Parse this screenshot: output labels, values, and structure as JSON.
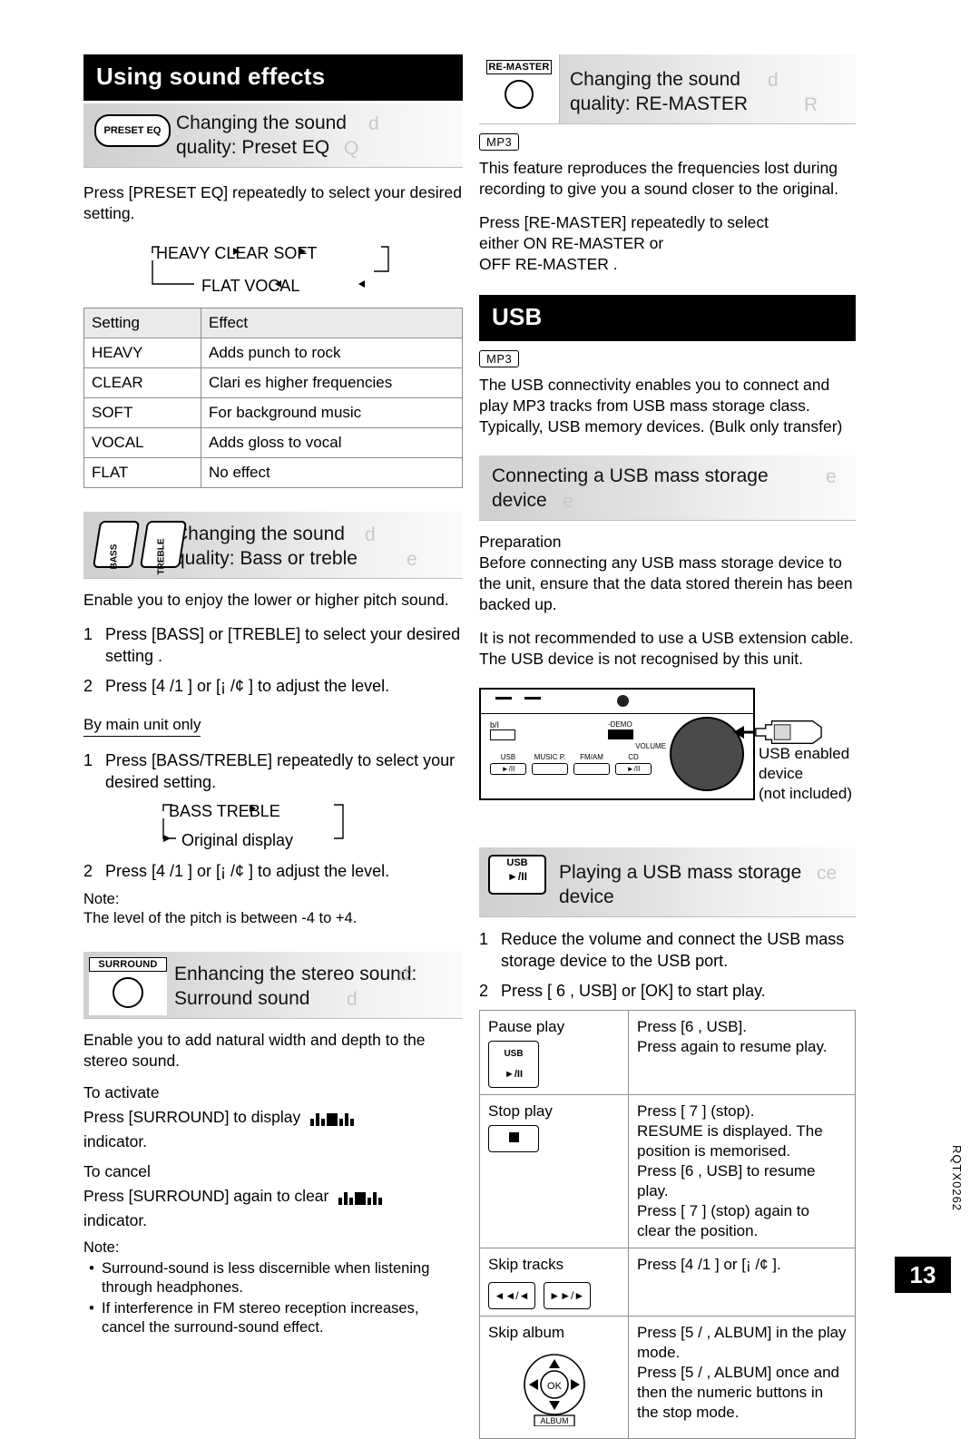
{
  "left": {
    "section_title": "Using sound effects",
    "preset_eq": {
      "icon_label": "PRESET EQ",
      "heading_line1": "Changing the sound",
      "heading_line2": "quality: Preset EQ",
      "ghost1": "d",
      "ghost2": "Q",
      "intro": "Press [PRESET EQ] repeatedly to select your desired setting.",
      "flow_top": "HEAVY       CLEAR       SOFT",
      "flow_bottom": "FLAT       VOCAL",
      "table": {
        "headers": [
          "Setting",
          "Effect"
        ],
        "rows": [
          [
            "HEAVY",
            "Adds punch to rock"
          ],
          [
            "CLEAR",
            "Clari es higher frequencies"
          ],
          [
            "SOFT",
            "For background music"
          ],
          [
            "VOCAL",
            "Adds gloss to vocal"
          ],
          [
            "FLAT",
            "No effect"
          ]
        ]
      }
    },
    "bass_treble": {
      "icon_bass": "BASS",
      "icon_treble": "TREBLE",
      "heading_line1": "Changing the sound",
      "heading_line2": "quality: Bass or treble",
      "ghost1": "d",
      "ghost2": "e",
      "intro": "Enable you to enjoy the lower or higher pitch sound.",
      "steps": [
        {
          "n": "1",
          "text": "Press [BASS] or [TREBLE] to select your desired setting ."
        },
        {
          "n": "2",
          "text": "Press  [4      /1     ] or [¡      /¢     ]  to  adjust  the level."
        }
      ],
      "mainunit_label": "By main unit only",
      "steps2": [
        {
          "n": "1",
          "text": "Press [BASS/TREBLE] repeatedly to select your desired setting."
        },
        {
          "n": "2",
          "text": "Press  [4      /1     ] or [¡      /¢     ]  to adjust the level."
        }
      ],
      "flow_top": "BASS      TREBLE",
      "flow_bottom": "Original display",
      "note_label": "Note:",
      "note_text": "The level of the pitch is between -4 to +4."
    },
    "surround": {
      "icon_label": "SURROUND",
      "heading_line1": "Enhancing the stereo sound:",
      "heading_line2": "Surround sound",
      "ghost1": "d:",
      "ghost2": "d",
      "intro": "Enable you to add natural width and depth to the stereo sound.",
      "to_activate": "To activate",
      "activate_text_pre": "Press [SURROUND] to display",
      "activate_text_post": "indicator.",
      "to_cancel": "To cancel",
      "cancel_text_pre": "Press [SURROUND] again to clear",
      "cancel_text_post": "indicator.",
      "note_label": "Note:",
      "notes": [
        "Surround-sound is less discernible when listening through headphones.",
        "If interference in FM stereo reception increases, cancel the surround-sound effect."
      ]
    }
  },
  "right": {
    "remaster": {
      "icon_label": "RE-MASTER",
      "heading_line1": "Changing the sound",
      "heading_line2": "quality: RE-MASTER",
      "ghost1": "d",
      "ghost2": "R",
      "mp3_badge": "MP3",
      "intro": "This feature reproduces the frequencies lost during recording to give you a sound closer to the original.",
      "instruction_line1": "Press [RE-MASTER] repeatedly to select",
      "instruction_line2": "either  ON RE-MASTER  or",
      "instruction_line3": "OFF RE-MASTER ."
    },
    "usb": {
      "section_title": "USB",
      "mp3_badge": "MP3",
      "intro": "The USB connectivity enables you to connect and play MP3 tracks from USB mass storage class. Typically, USB memory devices. (Bulk only transfer)",
      "connect": {
        "heading_line1": "Connecting a USB mass storage",
        "heading_line2": "device",
        "ghost1": "e",
        "ghost2": "e",
        "prep_label": "Preparation",
        "prep_text": "Before connecting any USB mass storage device to the unit, ensure that the data stored therein has been backed up.",
        "warn_text": "It is not recommended to use a USB extension cable. The USB device is not recognised by this unit.",
        "unit_labels": {
          "power": "b/I",
          "demo": "-DEMO",
          "volume": "VOLUME",
          "buttons": [
            "USB",
            "MUSIC P.",
            "FM/AM",
            "CD"
          ],
          "playpause": "►/II"
        },
        "callout_line1": "USB enabled",
        "callout_line2": "device",
        "callout_line3": "(not included)"
      },
      "playing": {
        "icon_line1": "USB",
        "icon_line2": "►/II",
        "heading": "Playing a USB mass storage device",
        "ghost": "ce",
        "steps": [
          {
            "n": "1",
            "text": "Reduce the volume and connect the USB mass storage device to the USB port."
          },
          {
            "n": "2",
            "text": "Press [ 6     , USB] or [OK] to start play."
          }
        ],
        "table_rows": [
          {
            "label": "Pause play",
            "button": "USB\n►/II",
            "btn_type": "usb",
            "text": "Press [6     , USB].\nPress again to resume play."
          },
          {
            "label": "Stop play",
            "btn_type": "stop",
            "text": "Press [ 7 ] (stop).\n RESUME  is displayed. The position is memorised.\nPress [6     , USB] to resume play.\nPress [ 7 ] (stop) again to clear the position."
          },
          {
            "label": "Skip tracks",
            "btn_type": "skip",
            "text": "Press [4     /1     ] or [¡     /¢     ]."
          },
          {
            "label": "Skip album",
            "btn_type": "album",
            "text": "Press [5 /     , ALBUM] in the play mode.\nPress [5 /     , ALBUM] once and then the numeric buttons in the stop mode."
          }
        ]
      }
    }
  },
  "footer": {
    "side_code": "RQTX0262",
    "page_number": "13"
  }
}
